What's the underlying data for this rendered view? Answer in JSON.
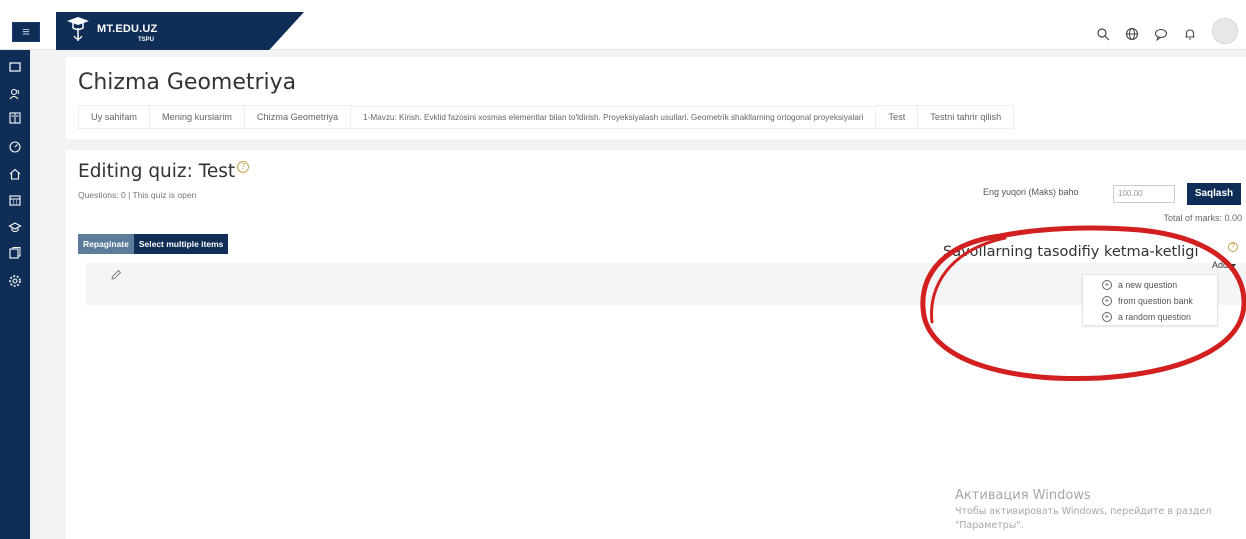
{
  "brand": {
    "name": "MT.EDU.UZ",
    "sub": "TSPU"
  },
  "topbar": {
    "menu_icon": "hamburger-icon",
    "icons": [
      "search-icon",
      "globe-icon",
      "chat-icon",
      "bell-icon",
      "avatar"
    ]
  },
  "sidebar": {
    "icons": [
      "folder-icon",
      "users-icon",
      "book-icon",
      "dashboard-icon",
      "home-icon",
      "calendar-icon",
      "graduation-icon",
      "files-icon",
      "settings-icon"
    ]
  },
  "header": {
    "title": "Chizma Geometriya",
    "breadcrumbs": [
      "Uy sahifam",
      "Mening kurslarim",
      "Chizma Geometriya",
      "1-Mavzu: Kirish. Evklid fazosini xosmas elementlar bilan to'ldirish. Proyeksiyalash usullari. Geometrik shakllarning ortogonal proyeksiyalari",
      "Test",
      "Testni tahrir qilish"
    ]
  },
  "quiz": {
    "title": "Editing quiz: Test",
    "help": "?",
    "status": "Questions: 0 | This quiz is open",
    "repaginate_label": "Repaginate",
    "select_multiple_label": "Select multiple items",
    "max_grade_label": "Eng yuqori (Maks) baho",
    "max_grade_value": "100.00",
    "save_label": "Saqlash",
    "total_marks": "Total of marks: 0.00"
  },
  "section": {
    "heading": "Savollarning tasodifiy ketma-ketligi",
    "help": "?",
    "add_label": "Add",
    "add_menu": [
      "a new question",
      "from question bank",
      "a random question"
    ]
  },
  "watermark": {
    "title": "Активация Windows",
    "subtitle": "Чтобы активировать Windows, перейдите в раздел \"Параметры\"."
  },
  "colors": {
    "primary": "#0f2d57",
    "secondary_button": "#5a7b9a",
    "annotation": "#d22020"
  }
}
